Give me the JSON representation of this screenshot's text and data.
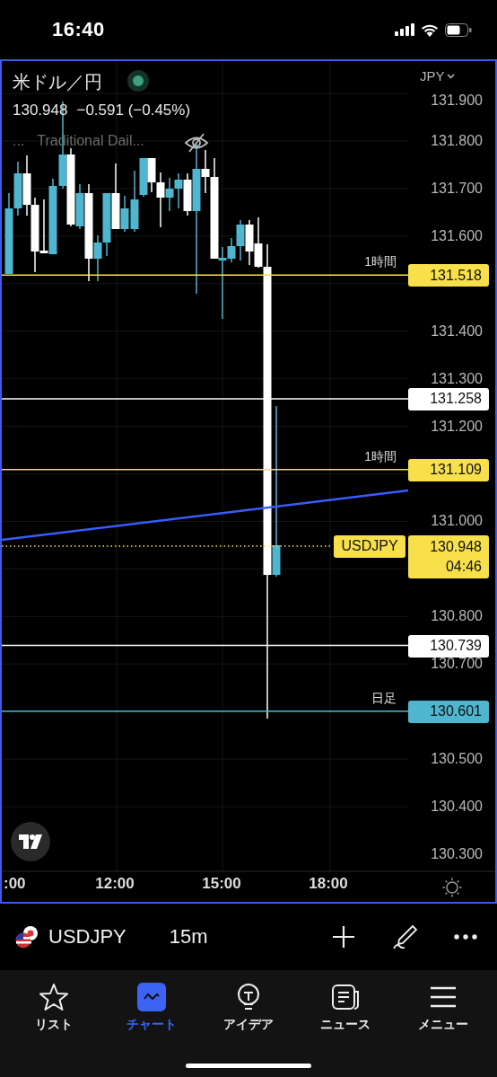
{
  "status_bar": {
    "time": "16:40"
  },
  "chart": {
    "title": "米ドル／円",
    "live": true,
    "price": "130.948",
    "change": "−0.591 (−0.45%)",
    "indicator": {
      "more": "...",
      "name": "Traditional Dail...",
      "hidden": true
    },
    "currency": "JPY",
    "price_axis": [
      "131.900",
      "131.800",
      "131.700",
      "131.600",
      "131.400",
      "131.300",
      "131.200",
      "131.000",
      "130.800",
      "130.700",
      "130.500",
      "130.400",
      "130.300"
    ],
    "levels": [
      {
        "price": "131.518",
        "label": "1時間",
        "color": "#f7e04b"
      },
      {
        "price": "131.258",
        "color": "#ffffff"
      },
      {
        "price": "131.109",
        "label": "1時間",
        "color": "#f7e04b"
      },
      {
        "price": "130.739",
        "color": "#ffffff"
      },
      {
        "price": "130.601",
        "label": "日足",
        "color": "#4fb6cf"
      }
    ],
    "current": {
      "symbol": "USDJPY",
      "price": "130.948",
      "countdown": "04:46"
    },
    "time_axis": [
      ":00",
      "12:00",
      "15:00",
      "18:00"
    ]
  },
  "symbol_bar": {
    "symbol": "USDJPY",
    "interval": "15m"
  },
  "tabs": [
    {
      "label": "リスト",
      "kind": "star",
      "selected": false
    },
    {
      "label": "チャート",
      "kind": "chart",
      "selected": true
    },
    {
      "label": "アイデア",
      "kind": "bulb",
      "selected": false
    },
    {
      "label": "ニュース",
      "kind": "news",
      "selected": false
    },
    {
      "label": "メニュー",
      "kind": "menu",
      "selected": false
    }
  ]
}
